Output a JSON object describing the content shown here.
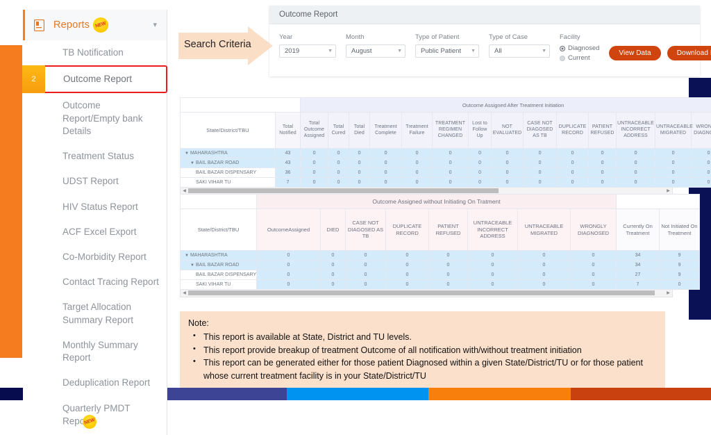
{
  "sidebar": {
    "header": {
      "title": "Reports",
      "badge": "NEW",
      "icon": "file-report-icon",
      "chevron": "chevron-down-icon"
    },
    "items": [
      {
        "label": "TB Notification",
        "selected": false,
        "badge": null
      },
      {
        "label": "Outcome Report",
        "selected": true,
        "badge": "2"
      },
      {
        "label": "Outcome Report/Empty bank Details",
        "selected": false,
        "badge": null
      },
      {
        "label": "Treatment Status",
        "selected": false,
        "badge": null
      },
      {
        "label": "UDST Report",
        "selected": false,
        "badge": null
      },
      {
        "label": "HIV Status Report",
        "selected": false,
        "badge": null
      },
      {
        "label": "ACF Excel Export",
        "selected": false,
        "badge": null
      },
      {
        "label": "Co-Morbidity Report",
        "selected": false,
        "badge": null
      },
      {
        "label": "Contact Tracing Report",
        "selected": false,
        "badge": null
      },
      {
        "label": "Target Allocation Summary Report",
        "selected": false,
        "badge": null
      },
      {
        "label": "Monthly Summary Report",
        "selected": false,
        "badge": null
      },
      {
        "label": "Deduplication Report",
        "selected": false,
        "badge": null
      },
      {
        "label": "Quarterly PMDT Report",
        "selected": false,
        "badge": "NEW"
      }
    ]
  },
  "callout": {
    "label": "Search Criteria"
  },
  "report_panel": {
    "title": "Outcome Report",
    "fields": [
      {
        "label": "Year",
        "value": "2019"
      },
      {
        "label": "Month",
        "value": "August"
      },
      {
        "label": "Type of Patient",
        "value": "Public Patient"
      },
      {
        "label": "Type of Case",
        "value": "All"
      }
    ],
    "facility": {
      "label": "Facility",
      "options": [
        {
          "label": "Diagnosed",
          "selected": true
        },
        {
          "label": "Current",
          "selected": false
        }
      ]
    },
    "buttons": [
      {
        "label": "View Data"
      },
      {
        "label": "Download Excel"
      }
    ]
  },
  "table1": {
    "group_header": "Outcome Assigned After Treatment Initiation",
    "row_label_header": "State/District/TBU",
    "pre_columns": [
      "Total Notified"
    ],
    "columns": [
      "Total Outcome Assigned",
      "Total Cured",
      "Total Died",
      "Treatment Complete",
      "Treatment Failure",
      "TREATMENT REGIMEN CHANGED",
      "Lost to Follow Up",
      "NOT EVALUATED",
      "CASE NOT DIAGOSED AS TB",
      "DUPLICATE RECORD",
      "PATIENT REFUSED",
      "UNTRACEABLE INCORRECT ADDRESS",
      "UNTRACEABLE MIGRATED",
      "WRONGLY DIAGNOSED"
    ],
    "rows": [
      {
        "name": "MAHARASHTRA",
        "level": 1,
        "expander": "▼",
        "total_notified": "43",
        "values": [
          "0",
          "0",
          "0",
          "0",
          "0",
          "0",
          "0",
          "0",
          "0",
          "0",
          "0",
          "0",
          "0",
          "0"
        ]
      },
      {
        "name": "BAIL BAZAR ROAD",
        "level": 2,
        "expander": "▼",
        "total_notified": "43",
        "values": [
          "0",
          "0",
          "0",
          "0",
          "0",
          "0",
          "0",
          "0",
          "0",
          "0",
          "0",
          "0",
          "0",
          "0"
        ]
      },
      {
        "name": "BAIL BAZAR DISPENSARY",
        "level": 3,
        "expander": "",
        "total_notified": "36",
        "values": [
          "0",
          "0",
          "0",
          "0",
          "0",
          "0",
          "0",
          "0",
          "0",
          "0",
          "0",
          "0",
          "0",
          "0"
        ]
      },
      {
        "name": "SAKI VIHAR TU",
        "level": 3,
        "expander": "",
        "total_notified": "7",
        "values": [
          "0",
          "0",
          "0",
          "0",
          "0",
          "0",
          "0",
          "0",
          "0",
          "0",
          "0",
          "0",
          "0",
          "0"
        ]
      }
    ]
  },
  "table2": {
    "group_header": "Outcome Assigned without Initiating On Tratment",
    "row_label_header": "State/District/TBU",
    "columns": [
      "OutcomeAssigned",
      "DIED",
      "CASE NOT DIAGOSED AS TB",
      "DUPLICATE RECORD",
      "PATIENT REFUSED",
      "UNTRACEABLE INCORRECT ADDRESS",
      "UNTRACEABLE MIGRATED",
      "WRONGLY DIAGNOSED"
    ],
    "trailing_columns": [
      "Currently On Treatment",
      "Not Initiated On Treatment"
    ],
    "rows": [
      {
        "name": "MAHARASHTRA",
        "level": 1,
        "expander": "▼",
        "values": [
          "0",
          "0",
          "0",
          "0",
          "0",
          "0",
          "0",
          "0"
        ],
        "trailing": [
          "34",
          "9"
        ]
      },
      {
        "name": "BAIL BAZAR ROAD",
        "level": 2,
        "expander": "▼",
        "values": [
          "0",
          "0",
          "0",
          "0",
          "0",
          "0",
          "0",
          "0"
        ],
        "trailing": [
          "34",
          "9"
        ]
      },
      {
        "name": "BAIL BAZAR DISPENSARY",
        "level": 3,
        "expander": "",
        "values": [
          "0",
          "0",
          "0",
          "0",
          "0",
          "0",
          "0",
          "0"
        ],
        "trailing": [
          "27",
          "9"
        ]
      },
      {
        "name": "SAKI VIHAR TU",
        "level": 3,
        "expander": "",
        "values": [
          "0",
          "0",
          "0",
          "0",
          "0",
          "0",
          "0",
          "0"
        ],
        "trailing": [
          "7",
          "0"
        ]
      }
    ]
  },
  "note": {
    "title": "Note:",
    "bullets": [
      "This report is available at State, District and TU levels.",
      "This report provide breakup of treatment Outcome of all notification with/without treatment initiation",
      "This report can be generated either for those patient Diagnosed within a given State/District/TU or for those patient whose current treatment facility is in your State/District/TU"
    ]
  },
  "decor": {
    "bottom_bar_colors": [
      "#060C4E",
      "#3D4496",
      "#0093F0",
      "#F97F0C",
      "#C9410F"
    ],
    "left_strip_color": "#F57C1F",
    "right_block_color": "#0B1155",
    "accent_orange": "#E8761E",
    "button_color": "#D0450F",
    "highlight_red": "#EE1C1C"
  }
}
